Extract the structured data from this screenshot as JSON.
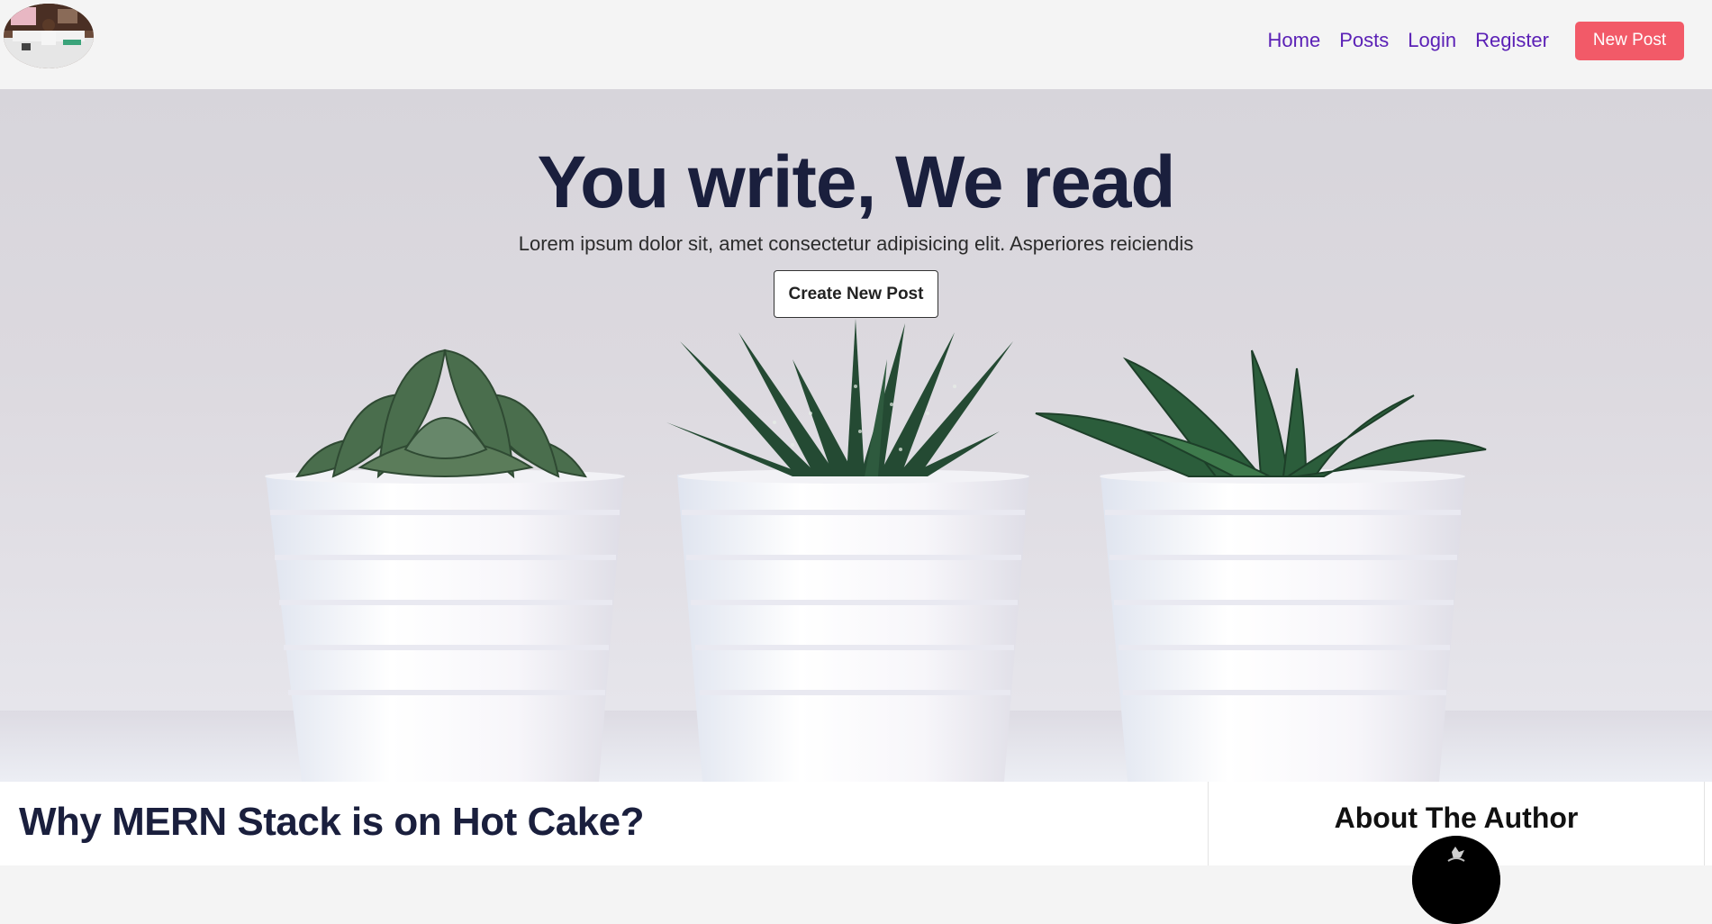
{
  "nav": {
    "links": [
      "Home",
      "Posts",
      "Login",
      "Register"
    ],
    "new_post_label": "New Post",
    "logo_icon": "profile-photo-logo"
  },
  "hero": {
    "title": "You write, We read",
    "subtitle": "Lorem ipsum dolor sit, amet consectetur adipisicing elit. Asperiores reiciendis",
    "button_label": "Create New Post",
    "image": "three-succulent-plants-in-white-pots"
  },
  "post": {
    "title": "Why MERN Stack is on Hot Cake?"
  },
  "sidebar": {
    "title": "About The Author",
    "avatar_icon": "author-avatar"
  },
  "colors": {
    "nav_link": "#5b21b6",
    "nav_button": "#f25a68",
    "hero_title": "#1a1f3d",
    "post_title": "#1a1f3d"
  }
}
